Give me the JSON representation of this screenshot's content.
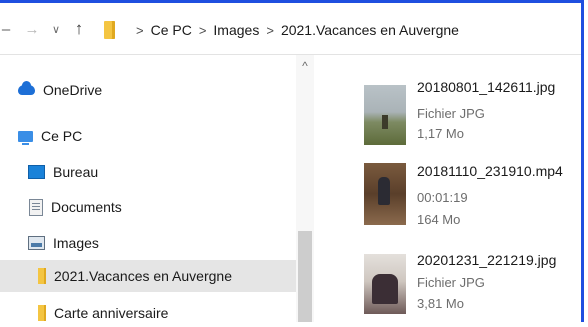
{
  "breadcrumb": {
    "items": [
      "Ce PC",
      "Images",
      "2021.Vacances en Auvergne"
    ],
    "separator": ">"
  },
  "nav_pane": {
    "items": [
      {
        "label": "OneDrive",
        "icon": "onedrive-icon"
      },
      {
        "label": "Ce PC",
        "icon": "pc-icon"
      },
      {
        "label": "Bureau",
        "icon": "desktop-icon"
      },
      {
        "label": "Documents",
        "icon": "documents-icon"
      },
      {
        "label": "Images",
        "icon": "images-icon"
      },
      {
        "label": "2021.Vacances en Auvergne",
        "icon": "folder-icon",
        "selected": true
      },
      {
        "label": "Carte anniversaire",
        "icon": "folder-icon"
      }
    ]
  },
  "files": [
    {
      "name": "20180801_142611.jpg",
      "line2": "Fichier JPG",
      "line3": "1,17 Mo"
    },
    {
      "name": "20181110_231910.mp4",
      "line2": "00:01:19",
      "line3": "164 Mo"
    },
    {
      "name": "20201231_221219.jpg",
      "line2": "Fichier JPG",
      "line3": "3,81 Mo"
    }
  ],
  "colors": {
    "frame_border": "#1f4fe0",
    "selected_bg": "#e5e5e5",
    "folder": "#f4c542"
  }
}
